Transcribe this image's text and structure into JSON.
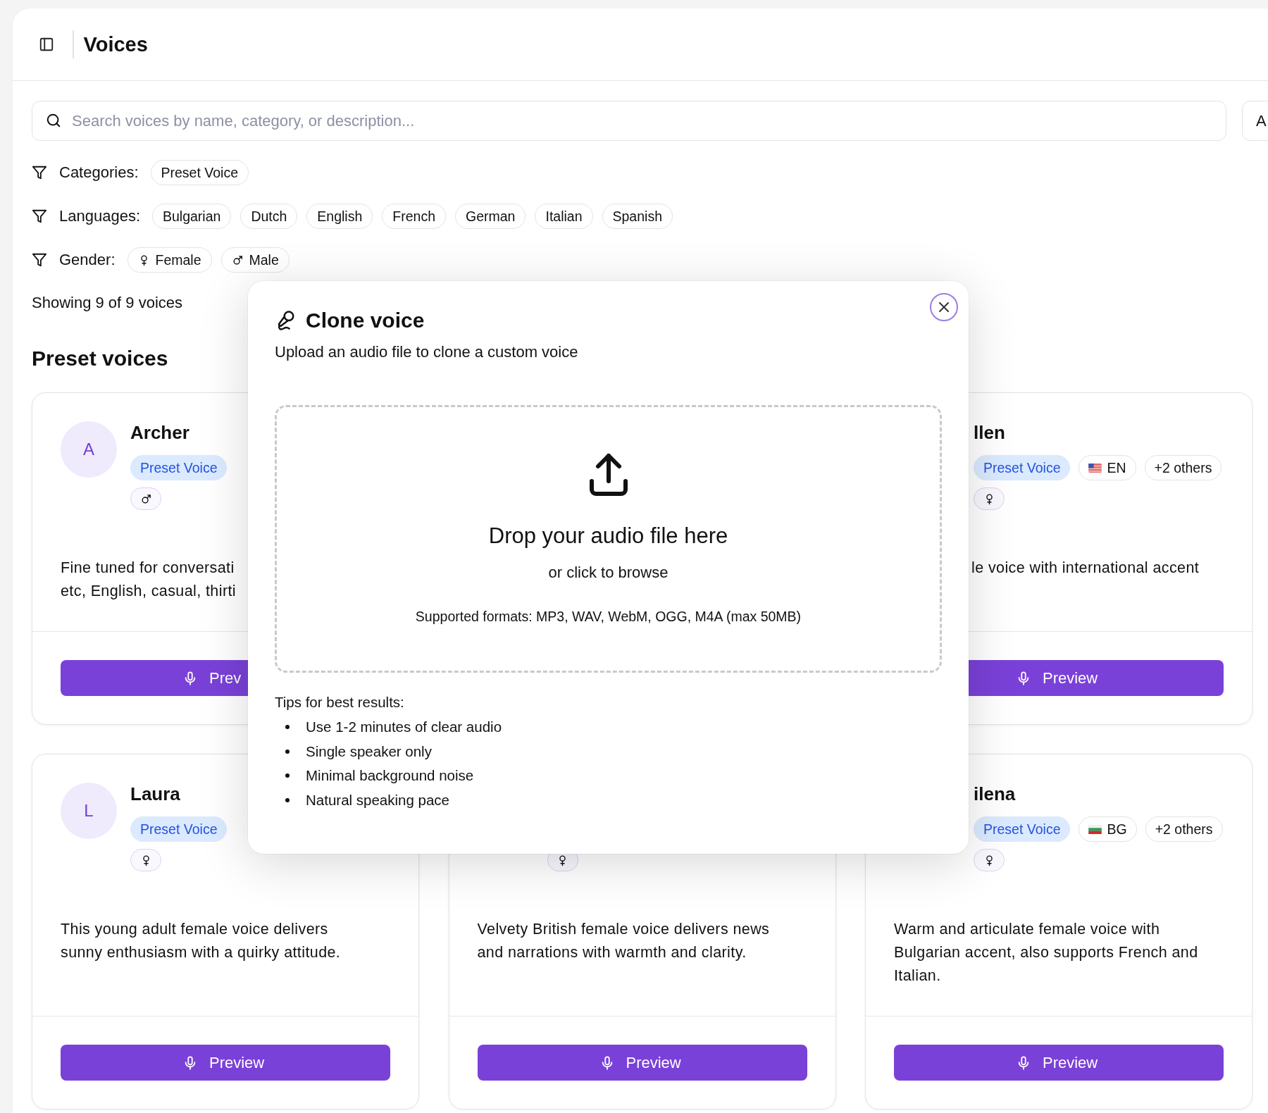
{
  "header": {
    "title": "Voices"
  },
  "search": {
    "placeholder": "Search voices by name, category, or description..."
  },
  "side_button": {
    "label": "A"
  },
  "filters": [
    {
      "label": "Categories:",
      "options": [
        {
          "label": "Preset Voice",
          "selected": false
        }
      ]
    },
    {
      "label": "Languages:",
      "options": [
        {
          "label": "Bulgarian",
          "selected": false
        },
        {
          "label": "Dutch",
          "selected": false
        },
        {
          "label": "English",
          "selected": false
        },
        {
          "label": "French",
          "selected": false
        },
        {
          "label": "German",
          "selected": false
        },
        {
          "label": "Italian",
          "selected": false
        },
        {
          "label": "Spanish",
          "selected": false
        }
      ]
    },
    {
      "label": "Gender:",
      "options": [
        {
          "label": "Female",
          "kind": "female",
          "selected": false
        },
        {
          "label": "Male",
          "kind": "male",
          "selected": false
        }
      ]
    }
  ],
  "result_count": "Showing 9 of 9 voices",
  "section_title": "Preset voices",
  "voices": [
    {
      "initial": "A",
      "name": "Archer",
      "tags": [
        {
          "kind": "category",
          "label": "Preset Voice"
        }
      ],
      "badge": {
        "kind": "male"
      },
      "description": "Fine tuned for conversati\netc, English, casual, thirti",
      "button": "Prev"
    },
    {
      "name": "llen",
      "tags": [
        {
          "kind": "category",
          "label": "Preset Voice"
        },
        {
          "kind": "usflag",
          "label": "EN"
        },
        {
          "kind": "more",
          "label": "+2 others"
        }
      ],
      "badge": {
        "kind": "female"
      },
      "description": "le voice with international accent",
      "button": "Preview"
    },
    {
      "initial": "L",
      "name": "Laura",
      "tags": [
        {
          "kind": "category",
          "label": "Preset Voice"
        }
      ],
      "badge": {
        "kind": "female"
      },
      "description": "This young adult female voice delivers sunny enthusiasm with a quirky attitude.",
      "button": "Preview"
    },
    {
      "badge": {
        "kind": "female"
      },
      "description": "Velvety British female voice delivers news and narrations with warmth and clarity.",
      "button": "Preview"
    },
    {
      "name": "ilena",
      "tags": [
        {
          "kind": "category",
          "label": "Preset Voice"
        },
        {
          "kind": "bgflag",
          "label": "BG"
        },
        {
          "kind": "more",
          "label": "+2 others"
        }
      ],
      "badge": {
        "kind": "female"
      },
      "description": "Warm and articulate female voice with Bulgarian accent, also supports French and Italian.",
      "button": "Preview"
    }
  ],
  "dialog": {
    "title": "Clone voice",
    "subtitle": "Upload an audio file to clone a custom voice",
    "dropzone": {
      "heading": "Drop your audio file here",
      "hint": "or click to browse",
      "formats": "Supported formats: MP3, WAV, WebM, OGG, M4A (max 50MB)"
    },
    "tips_title": "Tips for best results:",
    "tips": [
      "Use 1-2 minutes of clear audio",
      "Single speaker only",
      "Minimal background noise",
      "Natural speaking pace"
    ]
  }
}
